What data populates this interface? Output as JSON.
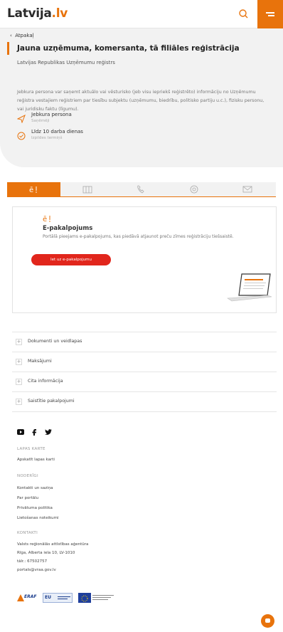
{
  "header": {
    "logo_text": "Latvija",
    "logo_suffix": ".lv"
  },
  "hero": {
    "back_label": "Atpakaļ",
    "title": "Jauna uzņēmuma, komersanta, tā filiāles reģistrācija",
    "provider": "Latvijas Republikas Uzņēmumu reģistrs",
    "description": "Jebkura persona var saņemt aktuālo vai vēsturisko (jeb visu iepriekš reģistrēto) informāciju no Uzņēmumu reģistra vestajiem reģistriem par tiesību subjektu (uzņēmumu, biedrību, politisko partiju u.c.), fizisku personu, vai juridisku faktu (līgumu).",
    "meta": [
      {
        "title": "Jebkura persona",
        "subtitle": "Saņēmēji"
      },
      {
        "title": "Līdz 10 darba dienas",
        "subtitle": "Izpildes termiņš"
      }
    ]
  },
  "tabs": [
    {
      "icon": "e-service-icon",
      "active": true
    },
    {
      "icon": "building-icon",
      "active": false
    },
    {
      "icon": "phone-icon",
      "active": false
    },
    {
      "icon": "at-icon",
      "active": false
    },
    {
      "icon": "envelope-icon",
      "active": false
    }
  ],
  "service_card": {
    "icon": "e-service-icon",
    "title": "E-pakalpojums",
    "description": "Portālā pieejams e-pakalpojums, kas piedāvā atjaunot preču zīmes reģistrāciju tiešsaistē.",
    "button_label": "Iet uz e-pakalpojumu",
    "illustration": "laptop-illustration"
  },
  "accordion": [
    {
      "label": "Dokumenti un veidlapas"
    },
    {
      "label": "Maksājumi"
    },
    {
      "label": "Cita informācija"
    },
    {
      "label": "Saistītie pakalpojumi"
    }
  ],
  "footer": {
    "social": [
      "youtube-icon",
      "facebook-icon",
      "twitter-icon"
    ],
    "sitemap": {
      "heading": "LAPAS KARTE",
      "link": "Apskatīt lapas karti"
    },
    "terms": {
      "heading": "NODERĪGI",
      "links": [
        "Kontakti un saziņa",
        "Par portālu",
        "Privātuma politika",
        "Lietošanas noteikumi"
      ]
    },
    "contacts": {
      "heading": "KONTAKTI",
      "lines": [
        "Valsts reģionālās attīstības aģentūra",
        "Rīga, Alberta iela 10, LV-1010",
        "tālr.: 67502757",
        "portals@vraa.gov.lv"
      ]
    },
    "logos": [
      "ERAF",
      "EU"
    ]
  },
  "colors": {
    "accent": "#e8730c",
    "cta": "#e1261c",
    "hero_bg": "#f2f2f2"
  }
}
